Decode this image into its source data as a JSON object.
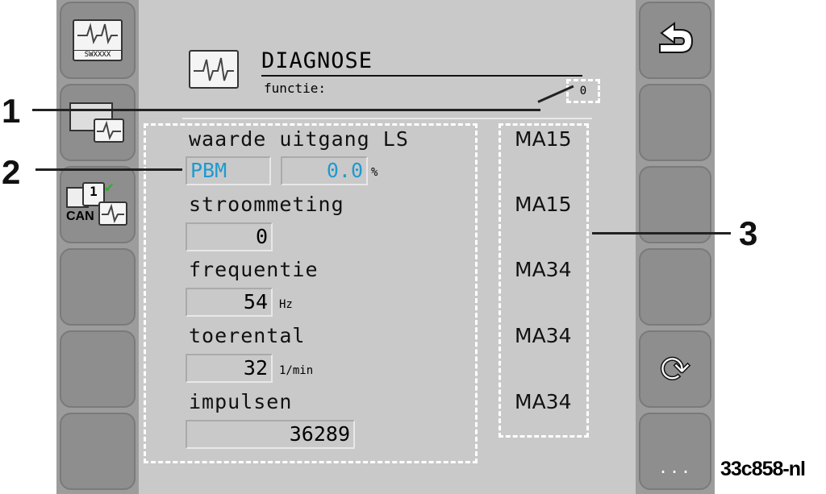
{
  "header": {
    "title": "DIAGNOSE",
    "function_label": "functie:",
    "function_value": "0"
  },
  "left_buttons": [
    {
      "icon": "diagnose-sw-icon",
      "label": "SWXXXX"
    },
    {
      "icon": "module-diagnose-icon"
    },
    {
      "icon": "can-diagnose-icon",
      "label": "CAN",
      "number": "1"
    },
    {},
    {},
    {}
  ],
  "right_buttons": [
    {
      "icon": "back-arrow-icon"
    },
    {},
    {},
    {},
    {
      "icon": "refresh-icon"
    },
    {
      "icon": "more-icon",
      "label": "..."
    }
  ],
  "rows": [
    {
      "label": "waarde uitgang LS",
      "select": "PBM",
      "value": "0.0",
      "unit": "%",
      "module": "MA15"
    },
    {
      "label": "stroommeting",
      "value": "0",
      "unit": "",
      "module": "MA15"
    },
    {
      "label": "frequentie",
      "value": "54",
      "unit": "Hz",
      "module": "MA34"
    },
    {
      "label": "toerental",
      "value": "32",
      "unit": "1/min",
      "module": "MA34"
    },
    {
      "label": "impulsen",
      "value": "36289",
      "unit": "",
      "module": "MA34"
    }
  ],
  "callouts": [
    "1",
    "2",
    "3"
  ],
  "figure_code": "33c858-nl",
  "colors": {
    "select_text": "#1e9ad0",
    "background": "#c9c9c9"
  }
}
